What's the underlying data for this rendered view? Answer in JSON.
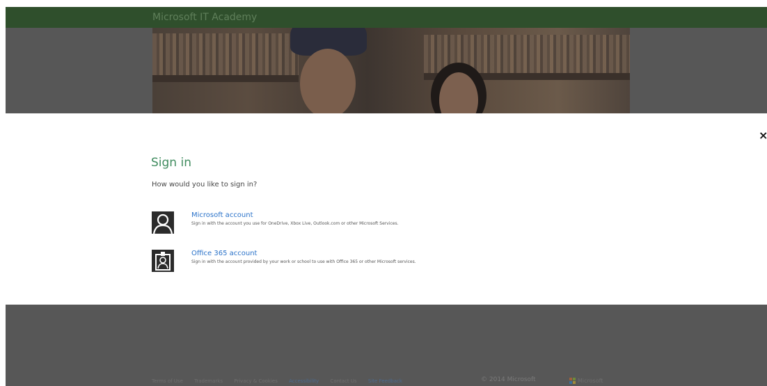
{
  "header": {
    "site_title": "Microsoft IT Academy"
  },
  "dialog": {
    "close_label": "×",
    "title": "Sign in",
    "question": "How would you like to sign in?",
    "options": [
      {
        "label": "Microsoft account",
        "description": "Sign in with the account you use for OneDrive, Xbox Live, Outlook.com or other Microsoft Services.",
        "icon": "person-silhouette-icon"
      },
      {
        "label": "Office 365 account",
        "description": "Sign in with the account provided by your work or school to use with Office 365 or other Microsoft services.",
        "icon": "id-badge-icon"
      }
    ]
  },
  "footer": {
    "links": [
      "Terms of Use",
      "Trademarks",
      "Privacy & Cookies",
      "Accessibility",
      "Contact Us",
      "Site Feedback"
    ],
    "copyright": "© 2014 Microsoft",
    "logo_text": "Microsoft"
  },
  "colors": {
    "header_green": "#2f4f2c",
    "title_green": "#3f8b5e",
    "link_blue": "#2a72c9",
    "dim_gray": "#575757"
  }
}
